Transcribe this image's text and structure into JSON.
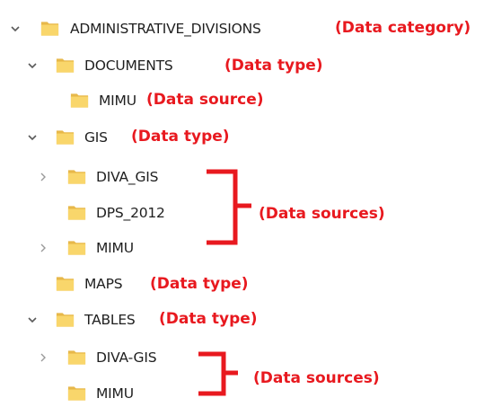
{
  "colors": {
    "annotation": "#e8191f",
    "folder_body": "#f9d66b",
    "folder_shade": "#e7b84a",
    "chevron": "#5a5a5a",
    "chevron_collapsed": "#9a9a9a"
  },
  "tree": {
    "administrative_divisions": {
      "label": "ADMINISTRATIVE_DIVISIONS",
      "annotation": "(Data category)"
    },
    "documents": {
      "label": "DOCUMENTS",
      "annotation": "(Data type)"
    },
    "documents_mimu": {
      "label": "MIMU",
      "annotation": "(Data source)"
    },
    "gis": {
      "label": "GIS",
      "annotation": "(Data type)"
    },
    "gis_diva_gis": {
      "label": "DIVA_GIS"
    },
    "gis_dps_2012": {
      "label": "DPS_2012"
    },
    "gis_mimu": {
      "label": "MIMU"
    },
    "maps": {
      "label": "MAPS",
      "annotation": "(Data type)"
    },
    "tables": {
      "label": "TABLES",
      "annotation": "(Data type)"
    },
    "tables_diva_gis": {
      "label": "DIVA-GIS"
    },
    "tables_mimu": {
      "label": "MIMU"
    }
  },
  "annotations": {
    "gis_sources": "(Data sources)",
    "tables_sources": "(Data sources)"
  },
  "icons": {
    "expanded": "chevron-down-icon",
    "collapsed": "chevron-right-icon",
    "folder": "folder-icon"
  }
}
